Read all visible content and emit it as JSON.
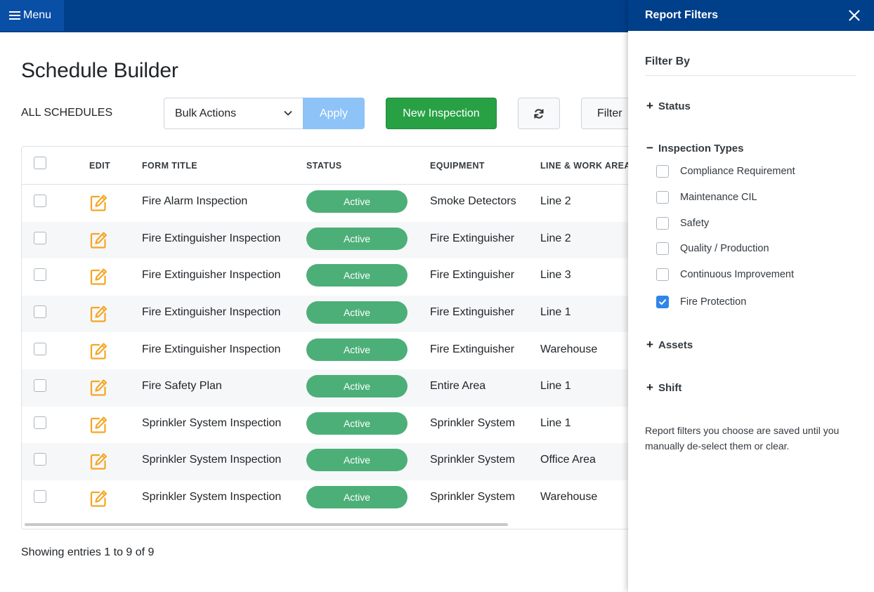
{
  "topbar": {
    "menu_label": "Menu"
  },
  "page": {
    "title": "Schedule Builder",
    "subtitle": "ALL SCHEDULES"
  },
  "toolbar": {
    "bulk_actions_selected": "Bulk Actions",
    "apply_label": "Apply",
    "new_inspection_label": "New Inspection",
    "filter_label": "Filter"
  },
  "table": {
    "headers": {
      "edit": "EDIT",
      "form_title": "FORM TITLE",
      "status": "STATUS",
      "equipment": "EQUIPMENT",
      "line_area": "LINE & WORK AREA"
    },
    "rows": [
      {
        "title": "Fire Alarm Inspection",
        "status": "Active",
        "equipment": "Smoke Detectors",
        "area": "Line 2"
      },
      {
        "title": "Fire Extinguisher Inspection",
        "status": "Active",
        "equipment": "Fire Extinguisher",
        "area": "Line 2"
      },
      {
        "title": "Fire Extinguisher Inspection",
        "status": "Active",
        "equipment": "Fire Extinguisher",
        "area": "Line 3"
      },
      {
        "title": "Fire Extinguisher Inspection",
        "status": "Active",
        "equipment": "Fire Extinguisher",
        "area": "Line 1"
      },
      {
        "title": "Fire Extinguisher Inspection",
        "status": "Active",
        "equipment": "Fire Extinguisher",
        "area": "Warehouse"
      },
      {
        "title": "Fire Safety Plan",
        "status": "Active",
        "equipment": "Entire Area",
        "area": "Line 1"
      },
      {
        "title": "Sprinkler System Inspection",
        "status": "Active",
        "equipment": "Sprinkler System",
        "area": "Line 1"
      },
      {
        "title": "Sprinkler System Inspection",
        "status": "Active",
        "equipment": "Sprinkler System",
        "area": "Office Area"
      },
      {
        "title": "Sprinkler System Inspection",
        "status": "Active",
        "equipment": "Sprinkler System",
        "area": "Warehouse"
      }
    ]
  },
  "footer": {
    "entries_text": "Showing entries 1 to 9 of 9"
  },
  "filters_panel": {
    "title": "Report Filters",
    "filter_by": "Filter By",
    "sections": {
      "status": {
        "label": "Status",
        "expanded": false
      },
      "inspection_types": {
        "label": "Inspection Types",
        "expanded": true,
        "options": [
          {
            "label": "Compliance Requirement",
            "checked": false
          },
          {
            "label": "Maintenance CIL",
            "checked": false
          },
          {
            "label": "Safety",
            "checked": false
          },
          {
            "label": "Quality / Production",
            "checked": false
          },
          {
            "label": "Continuous Improvement",
            "checked": false
          },
          {
            "label": "Fire Protection",
            "checked": true
          }
        ]
      },
      "assets": {
        "label": "Assets",
        "expanded": false
      },
      "shift": {
        "label": "Shift",
        "expanded": false
      }
    },
    "note": "Report filters you choose are saved until you manually de-select them or clear."
  },
  "colors": {
    "topbar": "#003f8a",
    "menu_button": "#0a4fa6",
    "primary_green": "#28a145",
    "status_active": "#4caf78",
    "apply_disabled": "#8dc3f7",
    "edit_icon": "#f5a623",
    "checkbox_checked": "#2f86e8"
  },
  "icons": {
    "menu": "hamburger-icon",
    "dropdown": "chevron-down-icon",
    "refresh": "refresh-icon",
    "edit": "edit-icon",
    "close": "close-icon",
    "expand": "plus-icon",
    "collapse": "minus-icon",
    "check": "checkmark-icon"
  }
}
